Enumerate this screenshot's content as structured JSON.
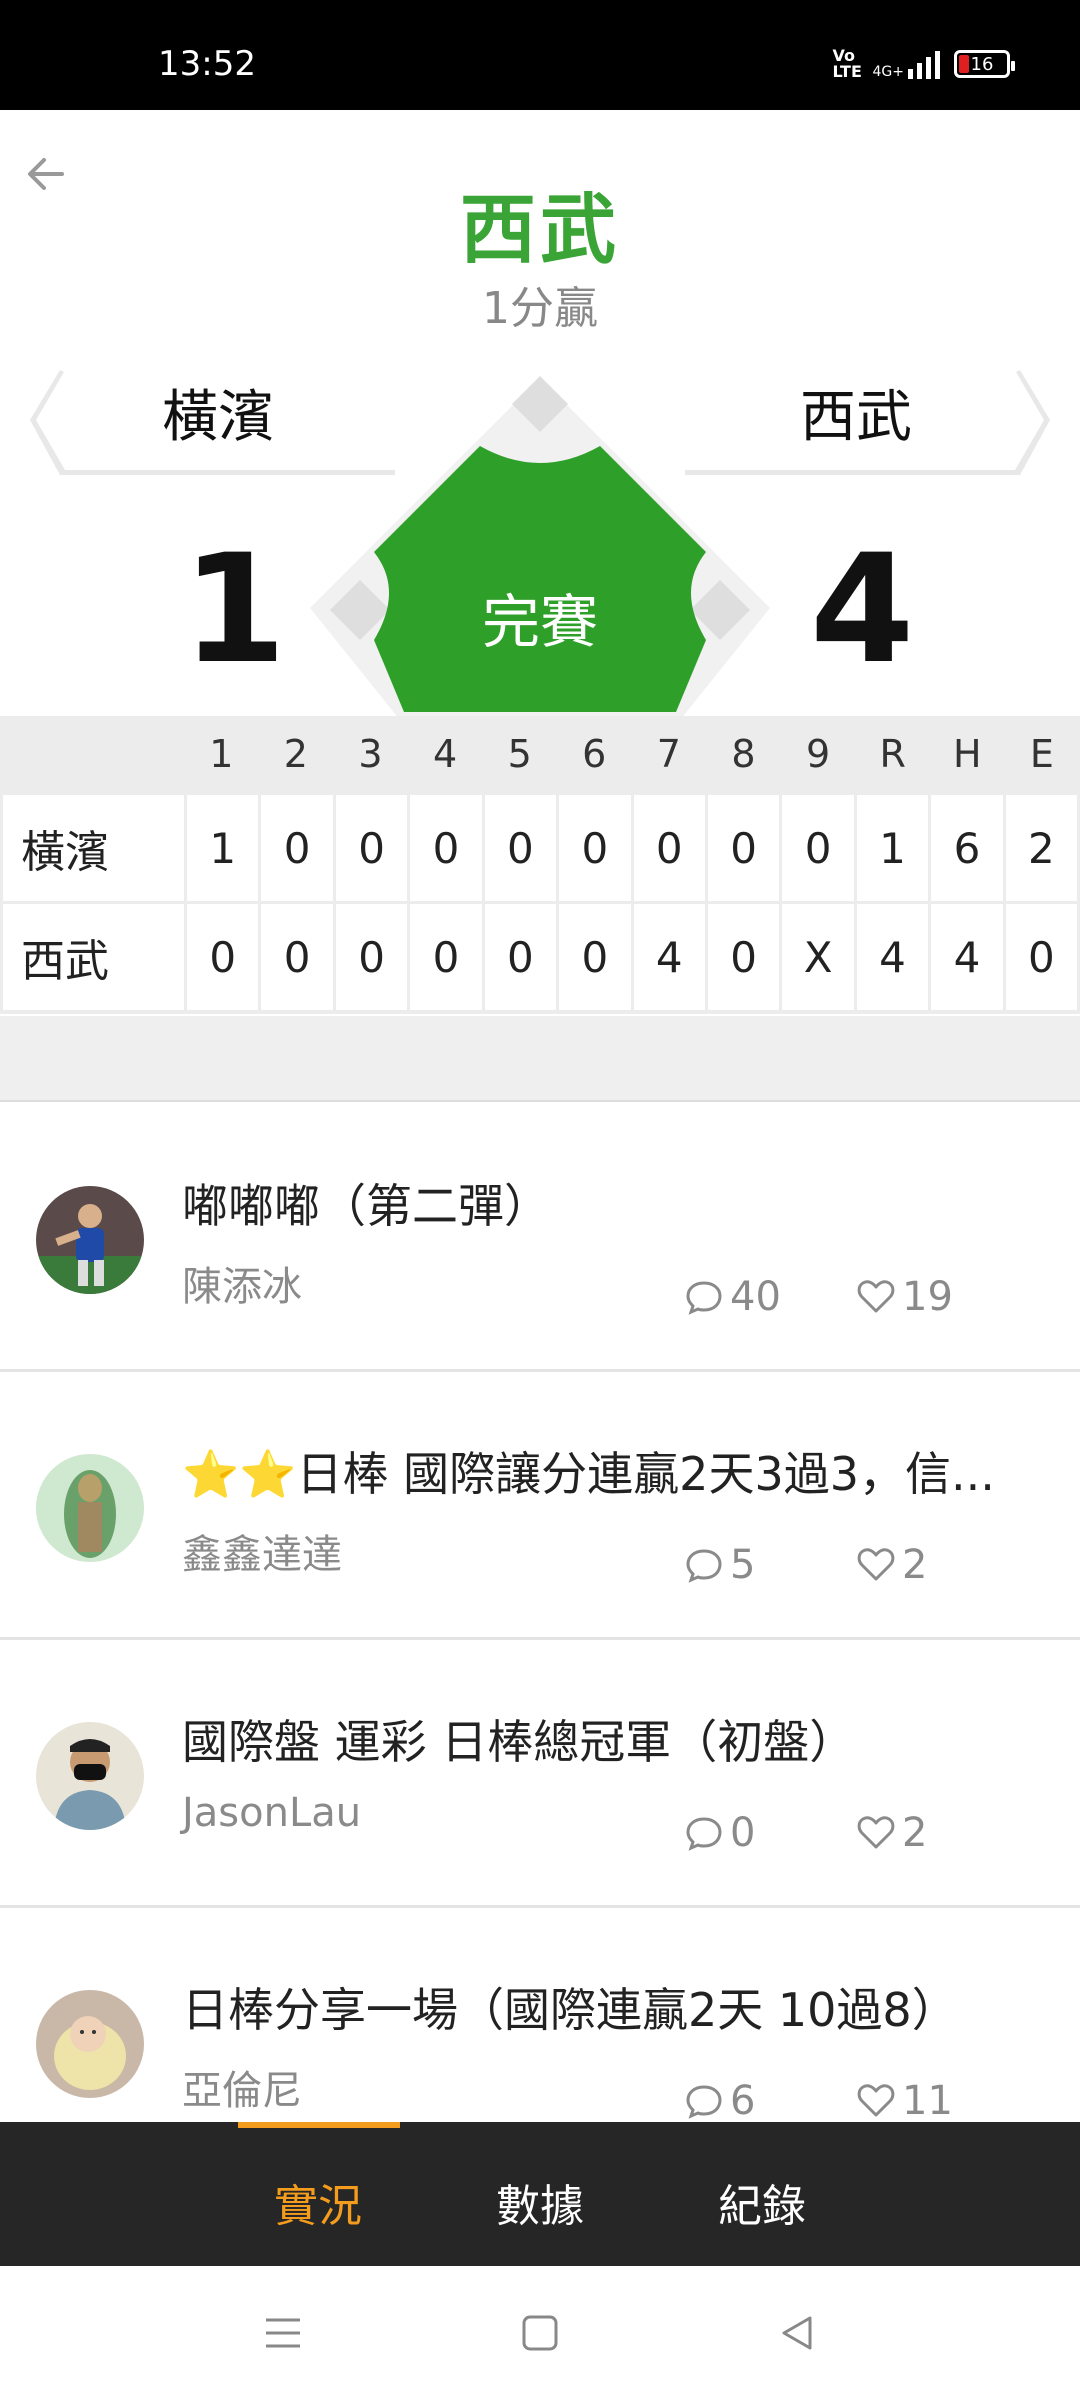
{
  "status_bar": {
    "time": "13:52",
    "volte": "Vo LTE",
    "network": "4G+",
    "battery": "16"
  },
  "header": {
    "winner": "西武",
    "result": "1分贏"
  },
  "scoreboard": {
    "away": {
      "name": "橫濱",
      "score": "1"
    },
    "home": {
      "name": "西武",
      "score": "4"
    },
    "status": "完賽",
    "colors": {
      "field": "#2ea02a",
      "diamond_bg": "#f1f1f1"
    }
  },
  "linescore": {
    "headers": [
      "1",
      "2",
      "3",
      "4",
      "5",
      "6",
      "7",
      "8",
      "9",
      "R",
      "H",
      "E"
    ],
    "rows": [
      {
        "team": "橫濱",
        "cells": [
          "1",
          "0",
          "0",
          "0",
          "0",
          "0",
          "0",
          "0",
          "0",
          "1",
          "6",
          "2"
        ]
      },
      {
        "team": "西武",
        "cells": [
          "0",
          "0",
          "0",
          "0",
          "0",
          "0",
          "4",
          "0",
          "X",
          "4",
          "4",
          "0"
        ]
      }
    ]
  },
  "posts": [
    {
      "title": "嘟嘟嘟（第二彈）",
      "author": "陳添冰",
      "comments": "40",
      "likes": "19",
      "avatar": "baseball-pitcher-avatar"
    },
    {
      "title": "⭐⭐日棒 國際讓分連贏2天3過3，信...",
      "author": "鑫鑫達達",
      "comments": "5",
      "likes": "2",
      "avatar": "green-statue-avatar"
    },
    {
      "title": "國際盤 運彩 日棒總冠軍（初盤）",
      "author": "JasonLau",
      "comments": "0",
      "likes": "2",
      "avatar": "masked-man-avatar"
    },
    {
      "title": "日棒分享一場（國際連贏2天 10過8）",
      "author": "亞倫尼",
      "comments": "6",
      "likes": "11",
      "avatar": "baby-avatar"
    }
  ],
  "tabs": [
    {
      "label": "實況",
      "active": true
    },
    {
      "label": "數據",
      "active": false
    },
    {
      "label": "紀錄",
      "active": false
    }
  ],
  "colors": {
    "accent_green": "#3aa536",
    "tab_active": "#f39c1e",
    "tabbar_bg": "#262626"
  }
}
